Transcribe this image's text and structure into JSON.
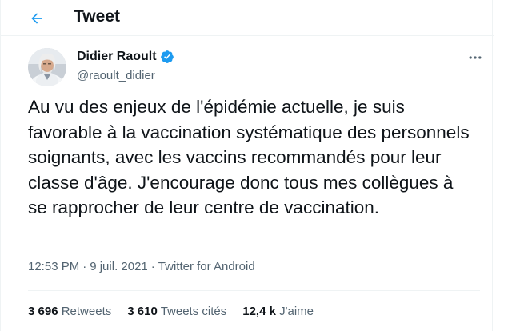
{
  "header": {
    "back_icon": "arrow-left-icon",
    "title": "Tweet"
  },
  "author": {
    "name": "Didier Raoult",
    "handle": "@raoult_didier",
    "verified_icon": "verified-badge-icon"
  },
  "tweet": {
    "text": "Au vu des enjeux de l'épidémie actuelle, je suis favorable à la vaccination systématique des personnels soignants, avec les vaccins recommandés pour leur classe d'âge. J'encourage donc tous mes collègues à se rapprocher de leur centre de vaccination.",
    "time": "12:53 PM",
    "date": "9 juil. 2021",
    "source": "Twitter for Android",
    "separator": "·"
  },
  "stats": {
    "retweets_count": "3 696",
    "retweets_label": "Retweets",
    "quotes_count": "3 610",
    "quotes_label": "Tweets cités",
    "likes_count": "12,4 k",
    "likes_label": "J'aime"
  },
  "colors": {
    "accent": "#1d9bf0",
    "text_primary": "#0f1419",
    "text_secondary": "#536471",
    "divider": "#eff3f4"
  }
}
